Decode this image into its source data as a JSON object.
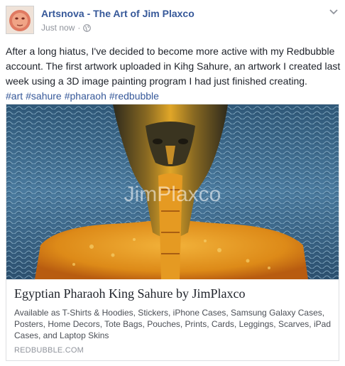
{
  "post": {
    "page_name": "Artsnova - The Art of Jim Plaxco",
    "timestamp": "Just now",
    "separator": "·",
    "privacy_icon": "globe-icon",
    "menu_icon": "chevron-down-icon",
    "text": "After a long hiatus, I've decided to become more active with my Redbubble account. The first artwork uploaded in Kihg Sahure, an artwork I created last week using a 3D image painting program I had just finished creating.",
    "hashtags": [
      "#art",
      "#sahure",
      "#pharaoh",
      "#redbubble"
    ]
  },
  "link_card": {
    "watermark": "JimPlaxco",
    "title": "Egyptian Pharaoh King Sahure by JimPlaxco",
    "description": "Available as T-Shirts & Hoodies, Stickers, iPhone Cases, Samsung Galaxy Cases, Posters, Home Decors, Tote Bags, Pouches, Prints, Cards, Leggings, Scarves, iPad Cases, and Laptop Skins",
    "domain": "REDBUBBLE.COM"
  },
  "colors": {
    "link": "#365899",
    "text": "#1d2129",
    "meta": "#90949c",
    "water": "#3d6a8e",
    "figure": "#e8a020"
  }
}
